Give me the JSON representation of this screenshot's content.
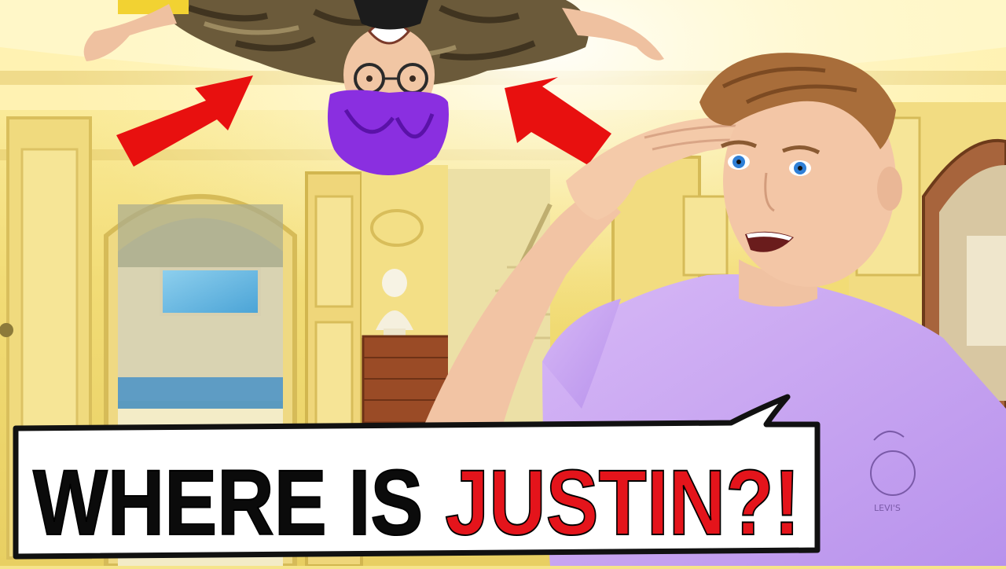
{
  "caption": {
    "part1": "WHERE IS ",
    "part2": "JUSTIN?!"
  },
  "shirt_brand": "LEVI'S",
  "colors": {
    "wall": "#f4df7a",
    "ceiling": "#fff3b0",
    "arrow": "#e8100f",
    "bubble_fill": "#ffffff",
    "bubble_stroke": "#111111",
    "caption_black": "#0b0b0b",
    "caption_red": "#e4141b",
    "shirt": "#c9a6f2",
    "hair_purple": "#8a2fe0",
    "skin": "#f3c6a6",
    "camo": "#6b5a3a"
  },
  "icons": [
    "left-arrow-icon",
    "right-arrow-icon"
  ]
}
